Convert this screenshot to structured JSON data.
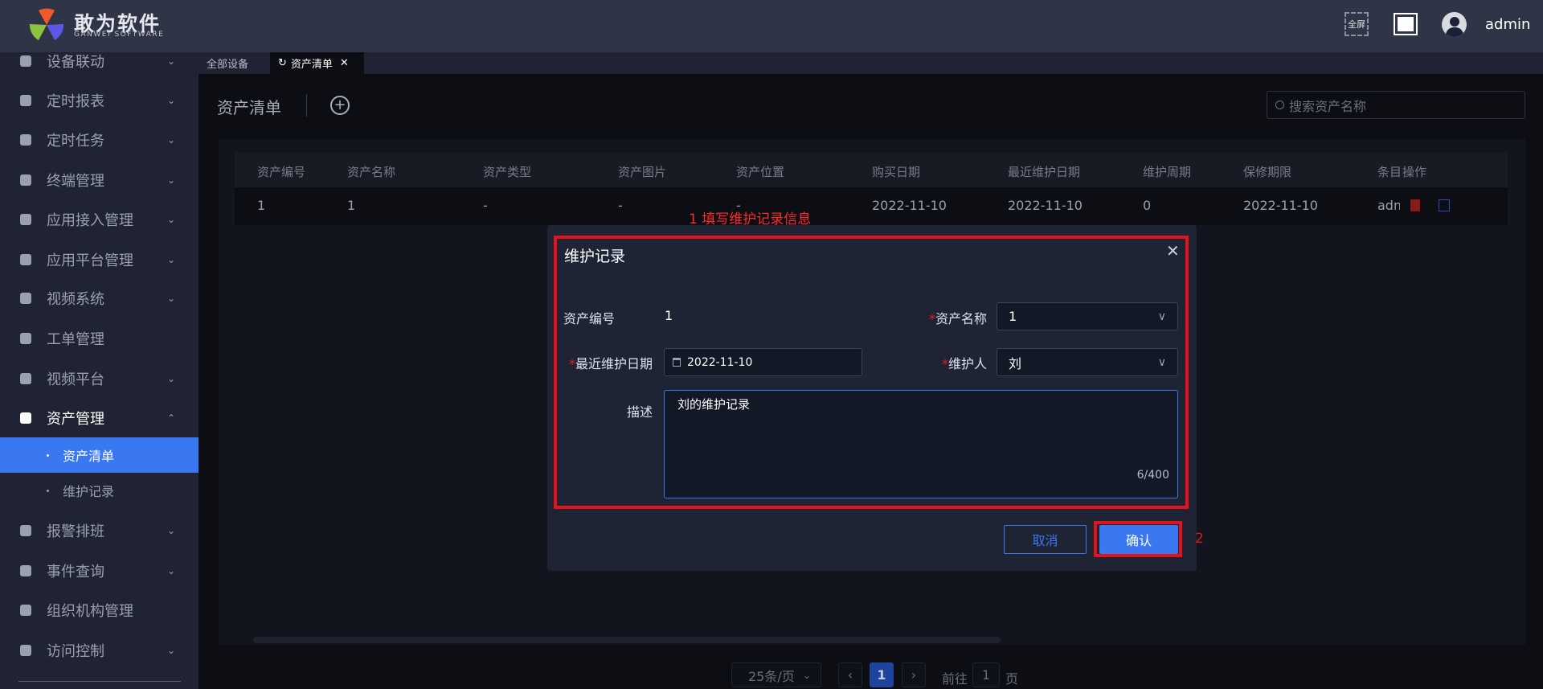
{
  "header": {
    "brand": "敢为软件",
    "brand_sub": "GANWEI SOFTWARE",
    "fullscreen_label": "全屏",
    "user": "admin",
    "colors": {
      "accent": "#3a78f2",
      "annotation": "#e5121c"
    }
  },
  "sidebar": {
    "items": [
      {
        "label": "设备联动",
        "chev": "⌄"
      },
      {
        "label": "定时报表",
        "chev": "⌄"
      },
      {
        "label": "定时任务",
        "chev": "⌄"
      },
      {
        "label": "终端管理",
        "chev": "⌄"
      },
      {
        "label": "应用接入管理",
        "chev": "⌄"
      },
      {
        "label": "应用平台管理",
        "chev": "⌄"
      },
      {
        "label": "视频系统",
        "chev": "⌄"
      },
      {
        "label": "工单管理"
      },
      {
        "label": "视频平台",
        "chev": "⌄"
      },
      {
        "label": "资产管理",
        "chev": "⌃"
      },
      {
        "label": "资产清单"
      },
      {
        "label": "维护记录"
      },
      {
        "label": "报警排班",
        "chev": "⌄"
      },
      {
        "label": "事件查询",
        "chev": "⌄"
      },
      {
        "label": "组织机构管理"
      },
      {
        "label": "访问控制",
        "chev": "⌄"
      }
    ]
  },
  "tabs": [
    {
      "label": "全部设备"
    },
    {
      "label": "资产清单",
      "refresh": "↻",
      "close": "✕"
    }
  ],
  "page": {
    "title": "资产清单",
    "add": "+",
    "search_placeholder": "搜索资产名称"
  },
  "table": {
    "headers": [
      "资产编号",
      "资产名称",
      "资产类型",
      "资产图片",
      "资产位置",
      "购买日期",
      "最近维护日期",
      "维护周期",
      "保修期限",
      "条目",
      "操作"
    ],
    "rows": [
      [
        "1",
        "1",
        "-",
        "-",
        "-",
        "2022-11-10",
        "2022-11-10",
        "0",
        "2022-11-10",
        "adm"
      ]
    ]
  },
  "annotations": {
    "step1": "1 填写维护记录信息",
    "step2": "2"
  },
  "pagination": {
    "page_size": "25条/页",
    "current": "1",
    "goto_label": "前往",
    "goto_value": "1",
    "page_suffix": "页"
  },
  "dialog": {
    "title": "维护记录",
    "close": "✕",
    "asset_no_label": "资产编号",
    "asset_no": "1",
    "asset_name_label": "资产名称",
    "asset_name": "1",
    "date_label": "最近维护日期",
    "date": "2022-11-10",
    "maintainer_label": "维护人",
    "maintainer": "刘",
    "desc_label": "描述",
    "desc": "刘的维护记录",
    "counter": "6/400",
    "required": "*",
    "cancel": "取消",
    "confirm": "确认"
  }
}
